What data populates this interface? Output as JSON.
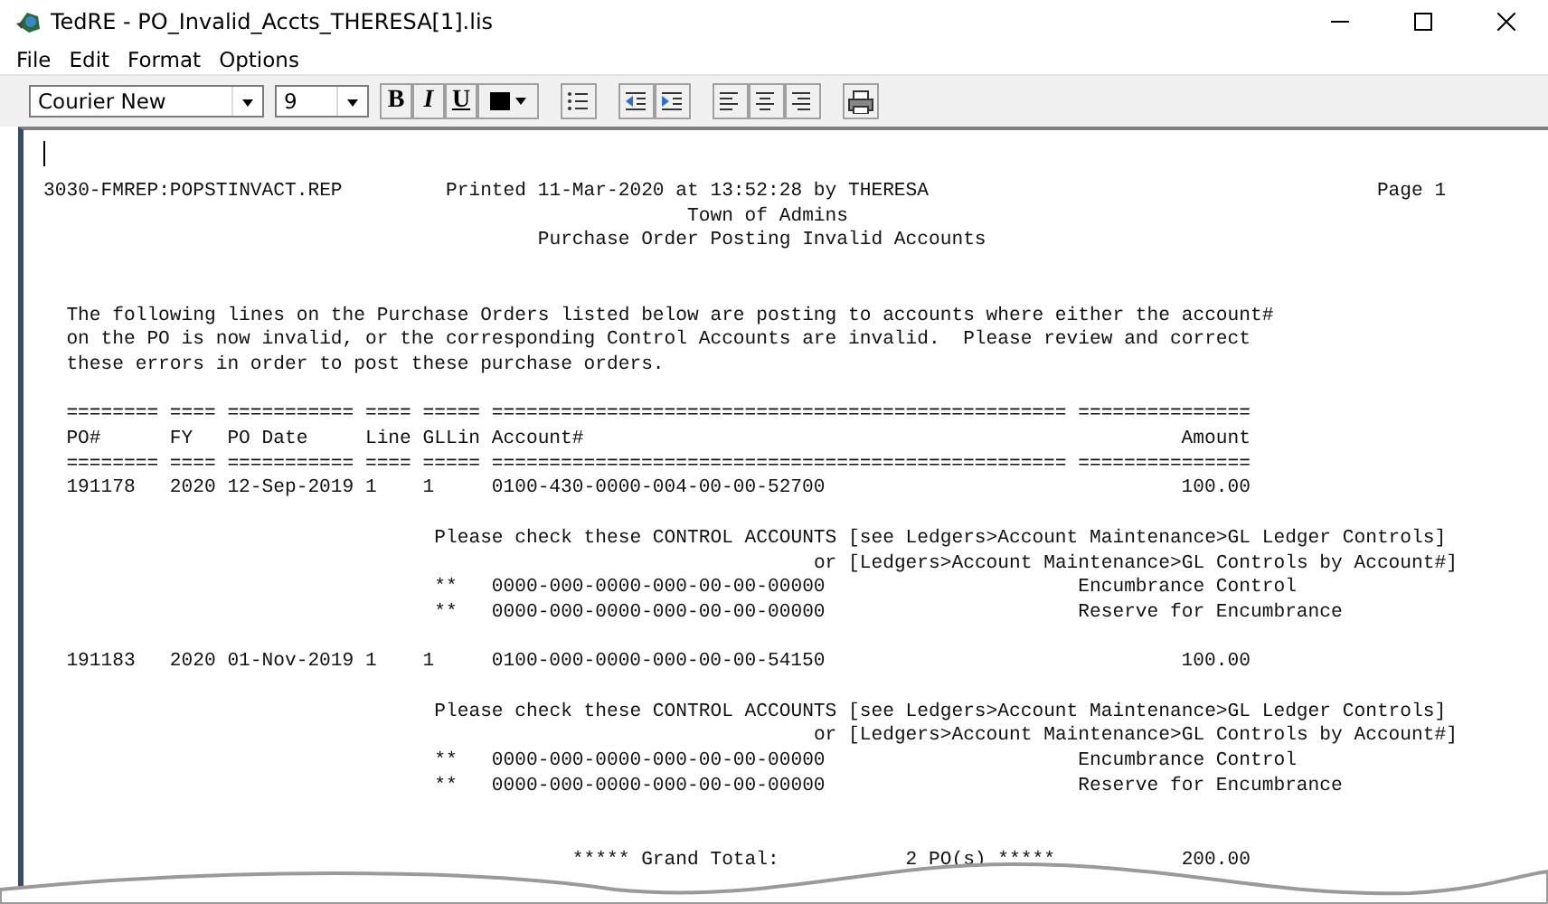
{
  "window": {
    "title": "TedRE - PO_Invalid_Accts_THERESA[1].lis"
  },
  "menu": [
    "File",
    "Edit",
    "Format",
    "Options"
  ],
  "toolbar": {
    "font": "Courier New",
    "size": "9",
    "buttons": [
      {
        "kind": "bold",
        "label": "B"
      },
      {
        "kind": "italic",
        "label": "I"
      },
      {
        "kind": "underline",
        "label": "U"
      },
      {
        "kind": "color"
      },
      {
        "kind": "bullets"
      },
      {
        "kind": "outdent"
      },
      {
        "kind": "indent"
      },
      {
        "kind": "align-left"
      },
      {
        "kind": "align-center"
      },
      {
        "kind": "align-right"
      },
      {
        "kind": "print"
      }
    ]
  },
  "report": {
    "header": {
      "report_id": "3030-FMREP:POPSTINVACT.REP",
      "printed": "Printed 11-Mar-2020 at 13:52:28 by THERESA",
      "page": "Page 1",
      "organization": "Town of Admins",
      "title": "Purchase Order Posting Invalid Accounts"
    },
    "intro": [
      "The following lines on the Purchase Orders listed below are posting to accounts where either the account#",
      "on the PO is now invalid, or the corresponding Control Accounts are invalid.  Please review and correct",
      "these errors in order to post these purchase orders."
    ],
    "columns": [
      {
        "label": "PO#",
        "rule_above": "========",
        "rule_below": "========"
      },
      {
        "label": "FY",
        "rule_above": "====",
        "rule_below": "===="
      },
      {
        "label": "PO Date",
        "rule_above": "===========",
        "rule_below": "==========="
      },
      {
        "label": "Line",
        "rule_above": "====",
        "rule_below": "===="
      },
      {
        "label": "GLLin",
        "rule_above": "=====",
        "rule_below": "====="
      },
      {
        "label": "Account#",
        "rule_above": "==================================================",
        "rule_below": "=================================================="
      },
      {
        "label": "Amount",
        "rule_above": "===============",
        "rule_below": "==============="
      }
    ],
    "orders": [
      {
        "po": "191178",
        "fy": "2020",
        "date": "12-Sep-2019",
        "line": "1",
        "gllin": "1",
        "account": "0100-430-0000-004-00-00-52700",
        "amount": "100.00",
        "note": [
          "Please check these CONTROL ACCOUNTS [see Ledgers>Account Maintenance>GL Ledger Controls]",
          "or [Ledgers>Account Maintenance>GL Controls by Account#]"
        ],
        "controls": [
          {
            "marker": "**",
            "account": "0000-000-0000-000-00-00-00000",
            "name": "Encumbrance Control"
          },
          {
            "marker": "**",
            "account": "0000-000-0000-000-00-00-00000",
            "name": "Reserve for Encumbrance"
          }
        ]
      },
      {
        "po": "191183",
        "fy": "2020",
        "date": "01-Nov-2019",
        "line": "1",
        "gllin": "1",
        "account": "0100-000-0000-000-00-00-54150",
        "amount": "100.00",
        "note": [
          "Please check these CONTROL ACCOUNTS [see Ledgers>Account Maintenance>GL Ledger Controls]",
          "or [Ledgers>Account Maintenance>GL Controls by Account#]"
        ],
        "controls": [
          {
            "marker": "**",
            "account": "0000-000-0000-000-00-00-00000",
            "name": "Encumbrance Control"
          },
          {
            "marker": "**",
            "account": "0000-000-0000-000-00-00-00000",
            "name": "Reserve for Encumbrance"
          }
        ]
      }
    ],
    "grand_total": {
      "label": "***** Grand Total:",
      "count": "2 PO(s) *****",
      "amount": "200.00"
    }
  }
}
